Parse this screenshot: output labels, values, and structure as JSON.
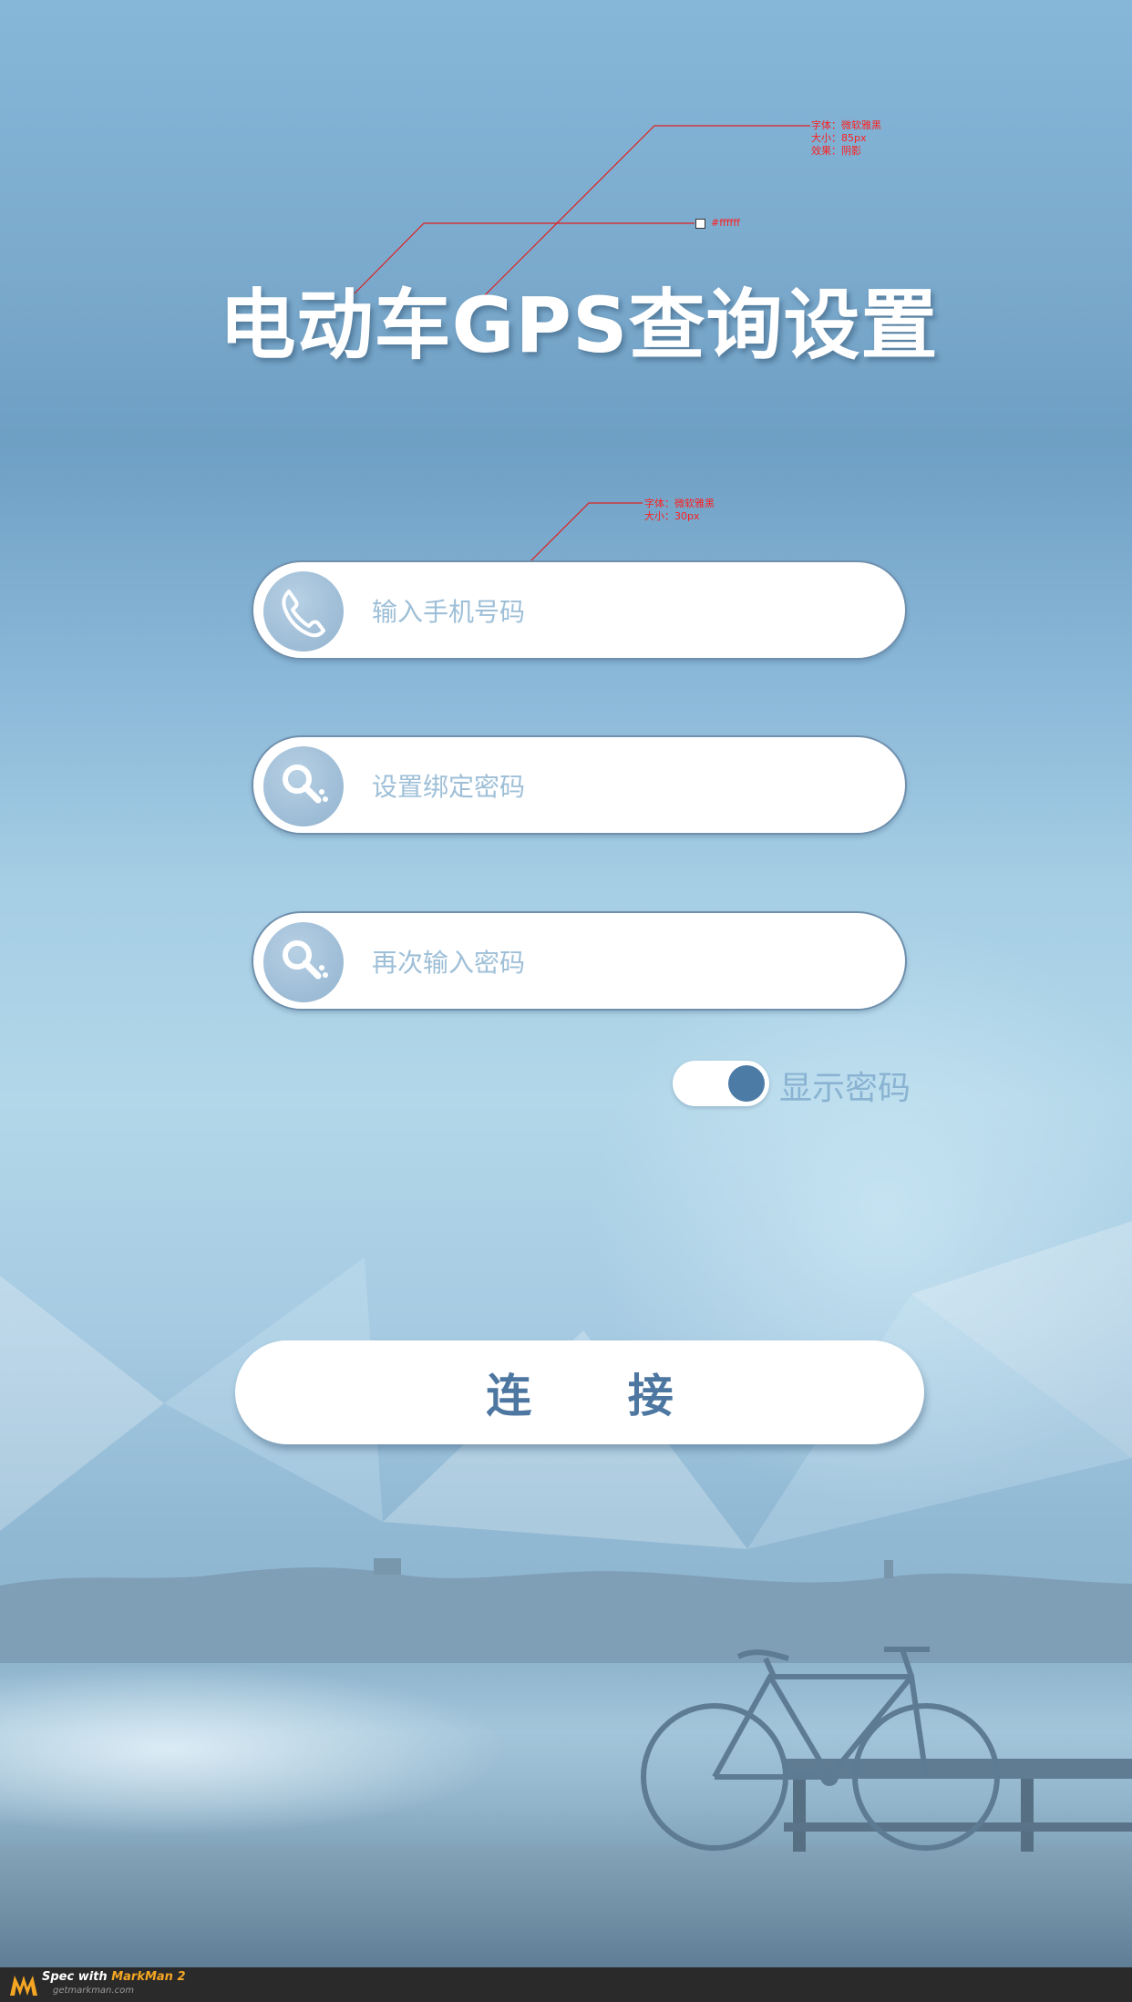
{
  "title": "电动车GPS查询设置",
  "annotations": {
    "title_font": "字体：微软雅黑",
    "title_size": "大小：85px",
    "title_effect": "效果：阴影",
    "title_color": "#ffffff",
    "input_font": "字体：微软雅黑",
    "input_size": "大小：30px",
    "input_color": "#9ebfd7"
  },
  "form": {
    "phone_placeholder": "输入手机号码",
    "password_placeholder": "设置绑定密码",
    "confirm_placeholder": "再次输入密码",
    "phone_icon": "phone-icon",
    "key_icon": "key-icon"
  },
  "toggle": {
    "label": "显示密码",
    "state": "on"
  },
  "connect_label": "连 接",
  "footer": {
    "spec": "Spec with ",
    "brand": "MarkMan 2",
    "url": "getmarkman.com"
  },
  "colors": {
    "placeholder": "#9ebfd7",
    "button_text": "#4d77a0",
    "toggle_knob": "#4c7ba6"
  }
}
